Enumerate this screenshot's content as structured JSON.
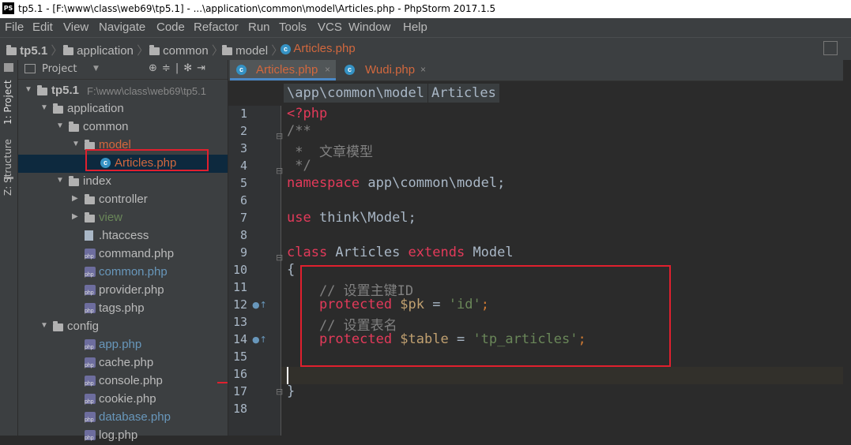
{
  "window": {
    "app_icon": "PS",
    "title": "tp5.1 - [F:\\www\\class\\web69\\tp5.1] - ...\\application\\common\\model\\Articles.php - PhpStorm 2017.1.5"
  },
  "menu": [
    "File",
    "Edit",
    "View",
    "Navigate",
    "Code",
    "Refactor",
    "Run",
    "Tools",
    "VCS",
    "Window",
    "Help"
  ],
  "breadcrumb": [
    "tp5.1",
    "application",
    "common",
    "model",
    "Articles.php"
  ],
  "side_tabs": {
    "project": "1: Project",
    "structure": "Z: Structure"
  },
  "project_panel": {
    "label": "Project",
    "tool_icons": [
      "⊕",
      "≑",
      "|",
      "✻",
      "⇥"
    ]
  },
  "tree": [
    {
      "label": "tp5.1",
      "path": "F:\\www\\class\\web69\\tp5.1",
      "type": "folder",
      "depth": 0,
      "expanded": true
    },
    {
      "label": "application",
      "type": "folder",
      "depth": 1,
      "expanded": true
    },
    {
      "label": "common",
      "type": "folder",
      "depth": 2,
      "expanded": true
    },
    {
      "label": "model",
      "type": "folder",
      "depth": 3,
      "expanded": true,
      "color": "#d2683e"
    },
    {
      "label": "Articles.php",
      "type": "class",
      "depth": 4,
      "selected": true,
      "color": "#d2683e"
    },
    {
      "label": "index",
      "type": "folder",
      "depth": 2,
      "expanded": true
    },
    {
      "label": "controller",
      "type": "folder",
      "depth": 3,
      "expanded": false
    },
    {
      "label": "view",
      "type": "folder",
      "depth": 3,
      "expanded": false,
      "color": "#6a8759"
    },
    {
      "label": ".htaccess",
      "type": "file",
      "depth": 3
    },
    {
      "label": "command.php",
      "type": "php",
      "depth": 3
    },
    {
      "label": "common.php",
      "type": "php",
      "depth": 3,
      "color": "#6897bb"
    },
    {
      "label": "provider.php",
      "type": "php",
      "depth": 3
    },
    {
      "label": "tags.php",
      "type": "php",
      "depth": 3
    },
    {
      "label": "config",
      "type": "folder",
      "depth": 1,
      "expanded": true
    },
    {
      "label": "app.php",
      "type": "php",
      "depth": 3,
      "color": "#6897bb"
    },
    {
      "label": "cache.php",
      "type": "php",
      "depth": 3
    },
    {
      "label": "console.php",
      "type": "php",
      "depth": 3
    },
    {
      "label": "cookie.php",
      "type": "php",
      "depth": 3
    },
    {
      "label": "database.php",
      "type": "php",
      "depth": 3,
      "color": "#6897bb"
    },
    {
      "label": "log.php",
      "type": "php",
      "depth": 3
    }
  ],
  "tabs": [
    {
      "label": "Articles.php",
      "close": "×",
      "active": true,
      "color": "#d2683e"
    },
    {
      "label": "Wudi.php",
      "close": "×",
      "active": false,
      "color": "#d2683e"
    }
  ],
  "ns_crumbs": [
    "\\app\\common\\model",
    "Articles"
  ],
  "line_numbers": [
    "1",
    "2",
    "3",
    "4",
    "5",
    "6",
    "7",
    "8",
    "9",
    "10",
    "11",
    "12",
    "13",
    "14",
    "15",
    "16",
    "17",
    "18"
  ],
  "code": {
    "l1": "<?php",
    "l2": "/**",
    "l3": " *  文章模型",
    "l4": " */",
    "l5_kw": "namespace",
    "l5_rest": " app\\common\\model;",
    "l7_kw": "use",
    "l7_rest": " think\\Model;",
    "l9_kw1": "class",
    "l9_name": " Articles ",
    "l9_kw2": "extends",
    "l9_rest": " Model",
    "l10": "{",
    "l11": "    // 设置主键ID",
    "l12_kw": "    protected",
    "l12_var": " $pk",
    "l12_eq": " = ",
    "l12_str": "'id'",
    "l12_end": ";",
    "l13": "    // 设置表名",
    "l14_kw": "    protected",
    "l14_var": " $table",
    "l14_eq": " = ",
    "l14_str": "'tp_articles'",
    "l14_end": ";",
    "l17": "}"
  },
  "colors": {
    "highlight_box": "#e0202e",
    "selection": "#0d293e",
    "accent": "#4a88c7"
  }
}
